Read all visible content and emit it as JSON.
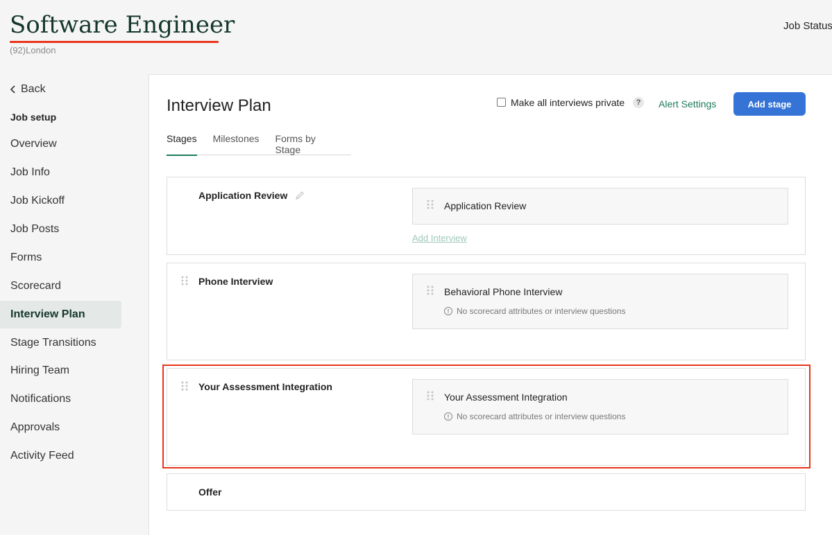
{
  "header": {
    "job_title": "Software Engineer",
    "job_subtitle": "(92)London",
    "job_status": "Job Status"
  },
  "sidebar": {
    "back_label": "Back",
    "section_label": "Job setup",
    "items": [
      {
        "label": "Overview",
        "active": false
      },
      {
        "label": "Job Info",
        "active": false
      },
      {
        "label": "Job Kickoff",
        "active": false
      },
      {
        "label": "Job Posts",
        "active": false
      },
      {
        "label": "Forms",
        "active": false
      },
      {
        "label": "Scorecard",
        "active": false
      },
      {
        "label": "Interview Plan",
        "active": true
      },
      {
        "label": "Stage Transitions",
        "active": false
      },
      {
        "label": "Hiring Team",
        "active": false
      },
      {
        "label": "Notifications",
        "active": false
      },
      {
        "label": "Approvals",
        "active": false
      },
      {
        "label": "Activity Feed",
        "active": false
      }
    ]
  },
  "main": {
    "title": "Interview Plan",
    "private_label": "Make all interviews private",
    "private_checked": false,
    "help_symbol": "?",
    "alert_settings_label": "Alert Settings",
    "add_stage_label": "Add stage",
    "tabs": [
      {
        "label": "Stages",
        "active": true
      },
      {
        "label": "Milestones",
        "active": false
      },
      {
        "label": "Forms by Stage",
        "active": false
      }
    ],
    "stages": [
      {
        "name": "Application Review",
        "interview": "Application Review",
        "note": "",
        "add_interview_label": "Add Interview"
      },
      {
        "name": "Phone Interview",
        "interview": "Behavioral Phone Interview",
        "note": "No scorecard attributes or interview questions"
      },
      {
        "name": "Your Assessment Integration",
        "interview": "Your Assessment Integration",
        "note": "No scorecard attributes or interview questions"
      },
      {
        "name": "Offer"
      }
    ]
  },
  "colors": {
    "accent_green": "#1e7b5b",
    "primary_blue": "#3574d6",
    "highlight_red": "#e8341c",
    "title_green": "#15372c"
  }
}
